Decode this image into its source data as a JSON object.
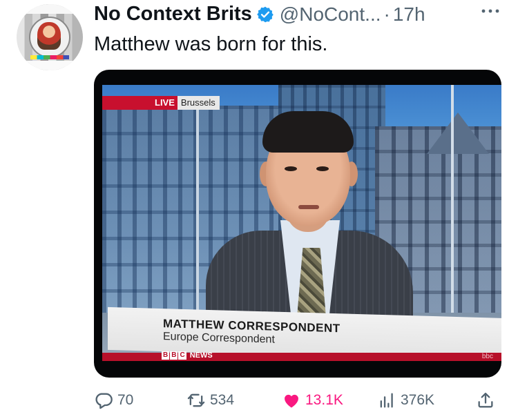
{
  "tweet": {
    "author_name": "No Context Brits",
    "handle": "@NoCont...",
    "separator": "·",
    "time": "17h",
    "text": "Matthew was born for this."
  },
  "media": {
    "live_tag": "LIVE",
    "location": "Brussels",
    "caption_name": "MATTHEW CORRESPONDENT",
    "caption_title": "Europe Correspondent",
    "brand_letters": [
      "B",
      "B",
      "C"
    ],
    "brand_news": "NEWS",
    "corner_logo": "bbc"
  },
  "actions": {
    "replies": "70",
    "retweets": "534",
    "likes": "13.1K",
    "views": "376K"
  },
  "icons": {
    "verified": "verified-badge-icon",
    "more": "more-dots-icon",
    "reply": "reply-icon",
    "retweet": "retweet-icon",
    "like": "heart-filled-icon",
    "views": "views-chart-icon",
    "share": "share-icon"
  },
  "colors": {
    "like_active": "#f91880",
    "secondary_text": "#536471",
    "verified_blue": "#1d9bf0",
    "bbc_red": "#c8102e"
  }
}
